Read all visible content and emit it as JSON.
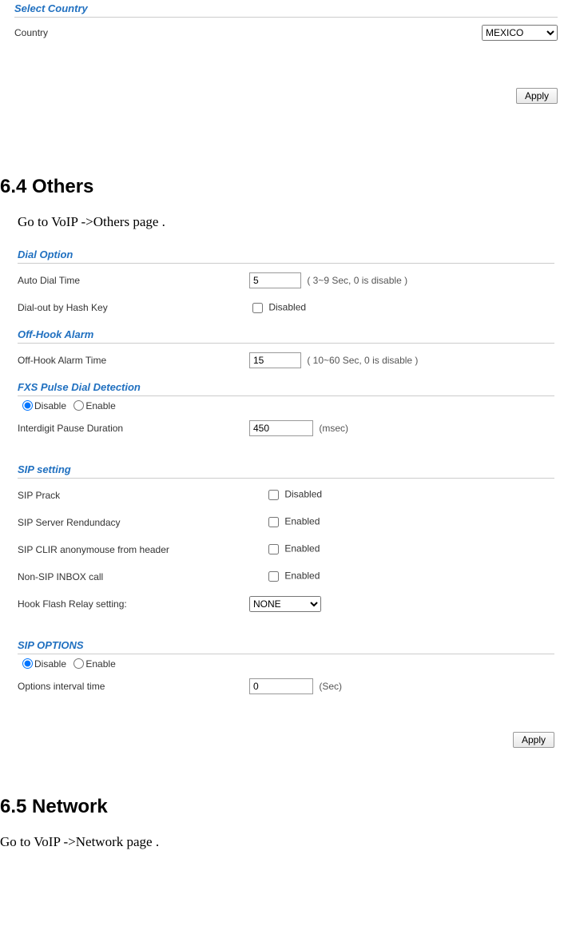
{
  "panel1": {
    "title": "Select Country",
    "country_label": "Country",
    "country_value": "MEXICO",
    "apply_label": "Apply"
  },
  "heading_others": "6.4 Others",
  "text_others": "Go to VoIP ->Others page .",
  "panel2": {
    "dial_option": {
      "title": "Dial Option",
      "auto_dial_label": "Auto Dial Time",
      "auto_dial_value": "5",
      "auto_dial_note": "( 3~9 Sec, 0 is disable )",
      "dial_hash_label": "Dial-out by Hash Key",
      "dial_hash_text": "Disabled"
    },
    "offhook": {
      "title": "Off-Hook Alarm",
      "alarm_label": "Off-Hook Alarm Time",
      "alarm_value": "15",
      "alarm_note": "( 10~60 Sec, 0 is disable )"
    },
    "fxs": {
      "title": "FXS Pulse Dial Detection",
      "disable": "Disable",
      "enable": "Enable",
      "interdigit_label": "Interdigit Pause Duration",
      "interdigit_value": "450",
      "interdigit_note": "(msec)"
    },
    "sip_setting": {
      "title": "SIP setting",
      "prack_label": "SIP Prack",
      "prack_text": "Disabled",
      "redundancy_label": "SIP Server Rendundacy",
      "redundancy_text": "Enabled",
      "clir_label": "SIP CLIR anonymouse from header",
      "clir_text": "Enabled",
      "nonsip_label": "Non-SIP INBOX call",
      "nonsip_text": "Enabled",
      "hookflash_label": "Hook Flash Relay setting:",
      "hookflash_value": "NONE"
    },
    "sip_options": {
      "title": "SIP OPTIONS",
      "disable": "Disable",
      "enable": "Enable",
      "interval_label": "Options interval time",
      "interval_value": "0",
      "interval_note": "(Sec)"
    },
    "apply_label": "Apply"
  },
  "heading_network": "6.5 Network",
  "text_network": "Go to VoIP ->Network page ."
}
